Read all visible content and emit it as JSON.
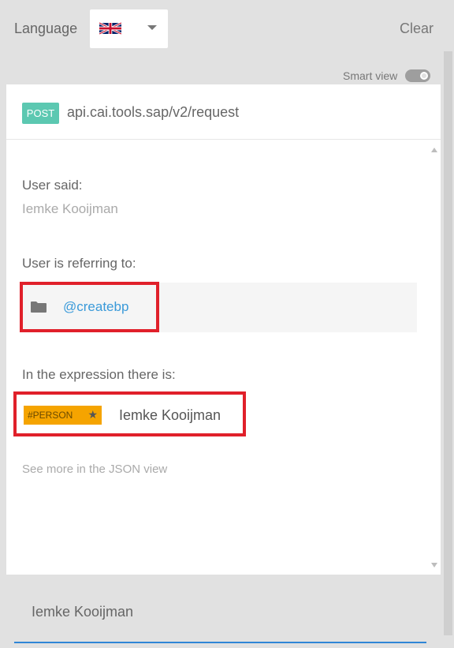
{
  "header": {
    "language_label": "Language",
    "flag_icon": "uk-flag-icon",
    "clear_label": "Clear"
  },
  "smart_view": {
    "label": "Smart view",
    "enabled": true
  },
  "request": {
    "method": "POST",
    "endpoint": "api.cai.tools.sap/v2/request"
  },
  "result": {
    "user_said_title": "User said:",
    "user_said_value": "Iemke Kooijman",
    "referring_title": "User is referring to:",
    "intent": "@createbp",
    "expression_title": "In the expression there is:",
    "entity_tag": "#PERSON",
    "entity_value": "Iemke Kooijman",
    "json_link": "See more in the JSON view"
  },
  "input": {
    "value": "Iemke Kooijman"
  },
  "colors": {
    "method_badge": "#5cc8b1",
    "entity_tag": "#f5a400",
    "link": "#3a9ad9",
    "highlight": "#e0202a",
    "input_underline": "#2f86d6"
  }
}
